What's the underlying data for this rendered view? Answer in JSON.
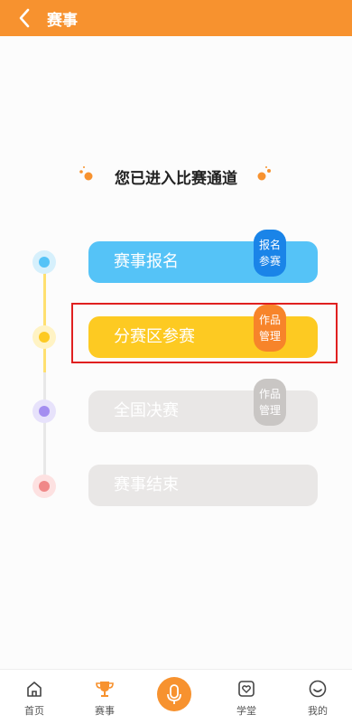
{
  "header": {
    "title": "赛事"
  },
  "heading": "您已进入比赛通道",
  "stages": [
    {
      "label": "赛事报名",
      "tag": [
        "报名",
        "参赛"
      ]
    },
    {
      "label": "分赛区参赛",
      "tag": [
        "作品",
        "管理"
      ]
    },
    {
      "label": "全国决赛",
      "tag": [
        "作品",
        "管理"
      ]
    },
    {
      "label": "赛事结束"
    }
  ],
  "nav": [
    {
      "label": "首页",
      "icon": "home-icon"
    },
    {
      "label": "赛事",
      "icon": "trophy-icon"
    },
    {
      "label": "",
      "icon": "microphone-icon"
    },
    {
      "label": "学堂",
      "icon": "heart-box-icon"
    },
    {
      "label": "我的",
      "icon": "smile-icon"
    }
  ],
  "colors": {
    "accent": "#f7922f",
    "stage1": "#55c3f7",
    "stage2": "#fdca22",
    "disabled": "#e9e7e6",
    "highlight": "#e02020"
  }
}
